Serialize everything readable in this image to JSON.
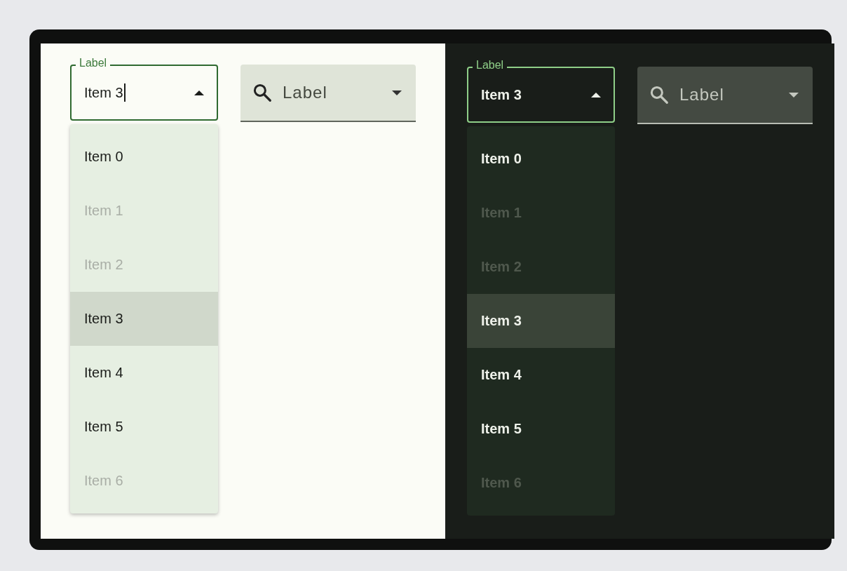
{
  "panels": [
    {
      "kind": "light",
      "select": {
        "label": "Label",
        "value": "Item 3",
        "text_cursor": true,
        "expanded": true
      },
      "search": {
        "placeholder": "Label"
      },
      "items": [
        {
          "label": "Item 0",
          "disabled": false,
          "selected": false
        },
        {
          "label": "Item 1",
          "disabled": true,
          "selected": false
        },
        {
          "label": "Item 2",
          "disabled": true,
          "selected": false
        },
        {
          "label": "Item 3",
          "disabled": false,
          "selected": true
        },
        {
          "label": "Item 4",
          "disabled": false,
          "selected": false
        },
        {
          "label": "Item 5",
          "disabled": false,
          "selected": false
        },
        {
          "label": "Item 6",
          "disabled": true,
          "selected": false
        }
      ]
    },
    {
      "kind": "dark",
      "select": {
        "label": "Label",
        "value": "Item 3",
        "text_cursor": false,
        "expanded": true
      },
      "search": {
        "placeholder": "Label"
      },
      "items": [
        {
          "label": "Item 0",
          "disabled": false,
          "selected": false
        },
        {
          "label": "Item 1",
          "disabled": true,
          "selected": false
        },
        {
          "label": "Item 2",
          "disabled": true,
          "selected": false
        },
        {
          "label": "Item 3",
          "disabled": false,
          "selected": true
        },
        {
          "label": "Item 4",
          "disabled": false,
          "selected": false
        },
        {
          "label": "Item 5",
          "disabled": false,
          "selected": false
        },
        {
          "label": "Item 6",
          "disabled": true,
          "selected": false
        }
      ]
    }
  ]
}
